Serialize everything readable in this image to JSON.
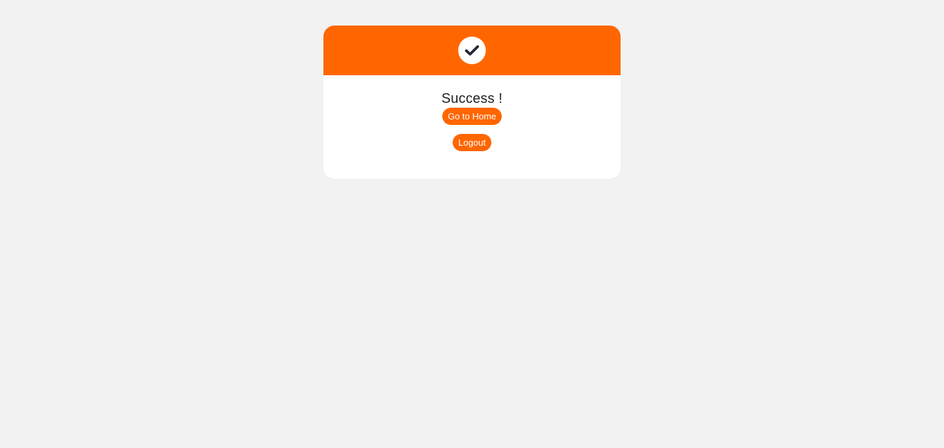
{
  "colors": {
    "accent": "#ff6600",
    "background": "#f2f2f2",
    "card": "#ffffff",
    "check": "#1f2a36"
  },
  "header": {
    "icon": "check-icon"
  },
  "message": {
    "title": "Success !"
  },
  "actions": {
    "home_label": "Go to Home",
    "logout_label": "Logout"
  }
}
